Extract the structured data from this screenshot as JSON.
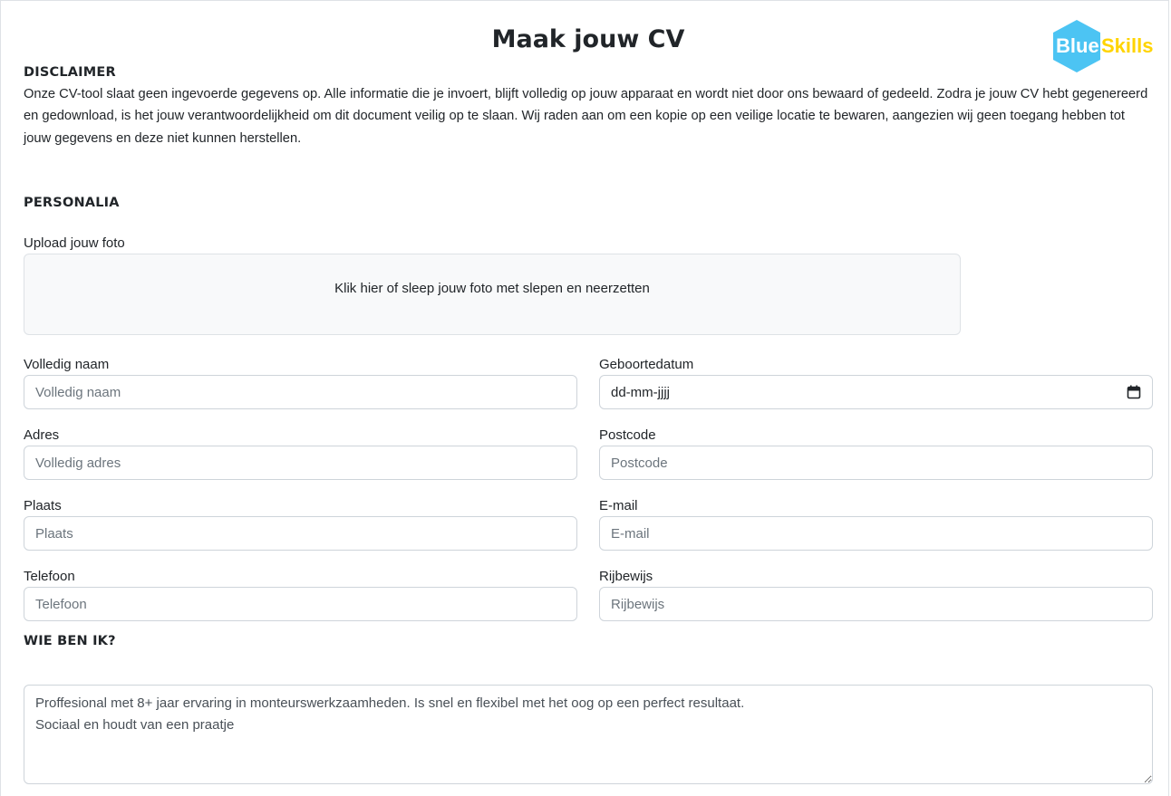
{
  "page": {
    "title": "Maak jouw CV"
  },
  "logo": {
    "text_blue": "Blue",
    "text_skills": "Skills",
    "colors": {
      "hexagon": "#4cc4f3",
      "skills": "#ffd400",
      "blue_text": "#ffffff"
    }
  },
  "disclaimer": {
    "heading": "DISCLAIMER",
    "text": "Onze CV-tool slaat geen ingevoerde gegevens op. Alle informatie die je invoert, blijft volledig op jouw apparaat en wordt niet door ons bewaard of gedeeld. Zodra je jouw CV hebt gegenereerd en gedownload, is het jouw verantwoordelijkheid om dit document veilig op te slaan. Wij raden aan om een kopie op een veilige locatie te bewaren, aangezien wij geen toegang hebben tot jouw gegevens en deze niet kunnen herstellen."
  },
  "personalia": {
    "heading": "PERSONALIA",
    "upload_label": "Upload jouw foto",
    "upload_prompt": "Klik hier of sleep jouw foto met slepen en neerzetten",
    "fields": {
      "name": {
        "label": "Volledig naam",
        "placeholder": "Volledig naam",
        "value": ""
      },
      "birthdate": {
        "label": "Geboortedatum",
        "value": "dd-mm-jjjj",
        "icon": "calendar-icon"
      },
      "address": {
        "label": "Adres",
        "placeholder": "Volledig adres",
        "value": ""
      },
      "postcode": {
        "label": "Postcode",
        "placeholder": "Postcode",
        "value": ""
      },
      "city": {
        "label": "Plaats",
        "placeholder": "Plaats",
        "value": ""
      },
      "email": {
        "label": "E-mail",
        "placeholder": "E-mail",
        "value": ""
      },
      "phone": {
        "label": "Telefoon",
        "placeholder": "Telefoon",
        "value": ""
      },
      "license": {
        "label": "Rijbewijs",
        "placeholder": "Rijbewijs",
        "value": ""
      }
    }
  },
  "about": {
    "heading": "WIE BEN IK?",
    "text": "Proffesional met 8+ jaar ervaring in monteurswerkzaamheden. Is snel en flexibel met het oog op een perfect resultaat.\nSociaal en houdt van een praatje"
  }
}
